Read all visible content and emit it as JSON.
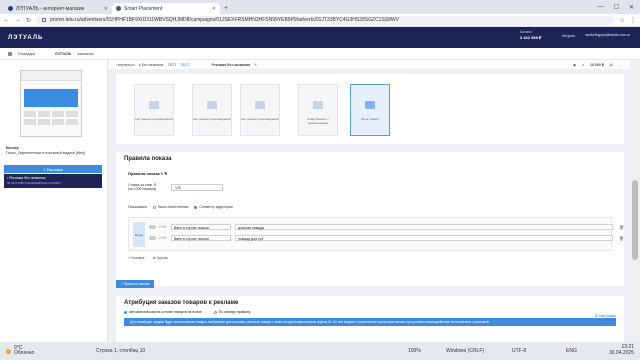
{
  "browser": {
    "tabs": [
      {
        "label": "ЛЭТУАЛЬ - интернет-магазин"
      },
      {
        "label": "Smart Placement"
      }
    ],
    "url": "promo.letu.ru/advertisers/01HPHF1BF9XID311WBVSQHJMD8/campaigns/01JSEXFRSMHN3HFSN99YEB9P9/adverts/01JT33BYC4G3HS28SGZC1SS8WV",
    "window_controls": [
      "—",
      "☐",
      "✕"
    ]
  },
  "topnav": {
    "logo": "ЛЭТУАЛЬ",
    "balance_label": "Баланс",
    "balance_value": "3 442 958 ₽",
    "user_label": "Летуаль",
    "email": "marketingoys@letoile.com.ru"
  },
  "subbar": {
    "items": [
      "Площадки",
      "ЛЭТУАЛЬ",
      "Кампании"
    ]
  },
  "leftpanel": {
    "preview_title": "Баннер",
    "preview_caption": "Поиск_Закрепленные в поисковой выдаче [Web]",
    "add_button": "+ Реклама",
    "selected_item_title": "• Реклама без названия",
    "selected_item_id": "ID 01JT33BYC4G3HS28SGZC1SS8WV"
  },
  "header": {
    "back": "‹ вернуться",
    "status": "● Без названия",
    "test1": "ТЕСТ",
    "test2": "ТЕСТ",
    "ad_title": "Реклама без названия",
    "budget": "10 000 ₽"
  },
  "formats": [
    {
      "label": "Нет данных рекомендаций",
      "selected": false
    },
    {
      "label": "Нет данных рекомендаций",
      "selected": false
    },
    {
      "label": "Нет данных рекомендаций",
      "selected": false
    },
    {
      "label": "Сейф Баннер + рекомендации",
      "selected": false
    },
    {
      "label": "Блок товара",
      "selected": true
    }
  ],
  "rules": {
    "title": "Правила показа",
    "rule_name": "Правила показа 1",
    "cpm_label": "Ставка за клик, ₽",
    "cpm_sub": "(за 1000 показов)",
    "cpm_value": "120",
    "show_label": "Показывать",
    "show_option_all": "Всем посетителям",
    "show_option_segment": "Сегменту аудитории",
    "and_label": "Везде",
    "conditions": [
      {
        "logic": "ИЛИ",
        "field": "Ввел в строке поиска",
        "value": "красная помада"
      },
      {
        "logic": "ИЛИ",
        "field": "Ввел в строке поиска",
        "value": "помада для губ"
      }
    ],
    "add_condition": "+ Условие",
    "add_group": "⊕ Группа",
    "add_rule_button": "+ Правило показа"
  },
  "attribution": {
    "title": "Атрибуция заказов товаров к рекламе",
    "option_auto": "Автоматическая на основе товаров на полке",
    "option_manual": "По своему правилу",
    "link": "⚙ Настройки",
    "note": "Для атрибуции продаж будут использованы товары, выбранные для рекламы, включая товары с теми же идентификаторами группы ID. Не все модели с различными характеристиками, при условии взаимодействия пользователя с рекламой."
  },
  "taskbar": {
    "temp": "9°C",
    "weather": "Облачно",
    "position": "Строка 1, столбец 10",
    "zoom": "100%",
    "eol": "Windows (CRLF)",
    "encoding": "UTF-8",
    "time": "13:21",
    "date": "30.04.2025",
    "lang": "ENG"
  }
}
